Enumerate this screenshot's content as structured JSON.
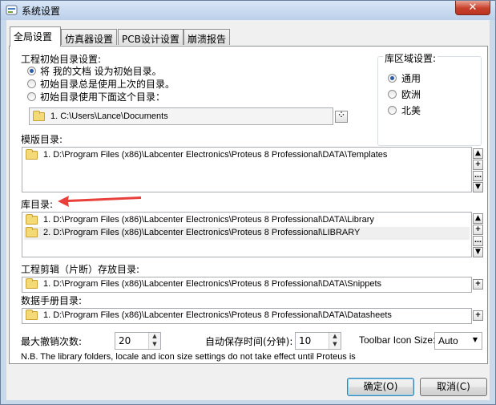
{
  "window": {
    "title": "系统设置",
    "close_label": "✕"
  },
  "tabs": [
    {
      "label": "全局设置",
      "active": true
    },
    {
      "label": "仿真器设置",
      "active": false
    },
    {
      "label": "PCB设计设置",
      "active": false
    },
    {
      "label": "崩溃报告",
      "active": false
    }
  ],
  "init_dir": {
    "label": "工程初始目录设置:",
    "options": [
      {
        "label": "将 我的文档 设为初始目录。",
        "selected": true
      },
      {
        "label": "初始目录总是使用上次的目录。",
        "selected": false
      },
      {
        "label": "初始目录使用下面这个目录：",
        "selected": false
      }
    ],
    "path": "1.  C:\\Users\\Lance\\Documents",
    "browse_icon": "browse-icon"
  },
  "locale": {
    "label": "库区域设置:",
    "options": [
      {
        "label": "通用",
        "selected": true
      },
      {
        "label": "欧洲",
        "selected": false
      },
      {
        "label": "北美",
        "selected": false
      }
    ]
  },
  "templates": {
    "label": "模版目录:",
    "items": [
      "1.   D:\\Program Files (x86)\\Labcenter Electronics\\Proteus 8 Professional\\DATA\\Templates"
    ]
  },
  "library": {
    "label": "库目录:",
    "items": [
      "1.   D:\\Program Files (x86)\\Labcenter Electronics\\Proteus 8 Professional\\DATA\\Library",
      "2.   D:\\Program Files (x86)\\Labcenter Electronics\\Proteus 8 Professional\\LIBRARY"
    ]
  },
  "snippets": {
    "label": "工程剪辑（片断）存放目录:",
    "items": [
      "1.   D:\\Program Files (x86)\\Labcenter Electronics\\Proteus 8 Professional\\DATA\\Snippets"
    ]
  },
  "datasheets": {
    "label": "数据手册目录:",
    "items": [
      "1.   D:\\Program Files (x86)\\Labcenter Electronics\\Proteus 8 Professional\\DATA\\Datasheets"
    ]
  },
  "undo": {
    "label": "最大撤销次数:",
    "value": "20"
  },
  "autosave": {
    "label": "自动保存时间(分钟):",
    "value": "10"
  },
  "toolbar_icon": {
    "label": "Toolbar Icon Size:",
    "value": "Auto"
  },
  "note": "N.B. The library folders, locale and icon size settings do not take effect until Proteus is res",
  "list_buttons": {
    "up": "▲",
    "add": "+",
    "edit": "…",
    "down": "▼"
  },
  "buttons": {
    "ok": "确定(O)",
    "cancel": "取消(C)"
  },
  "colors": {
    "accent": "#2a5cab",
    "annotation_arrow": "#e8413b"
  }
}
